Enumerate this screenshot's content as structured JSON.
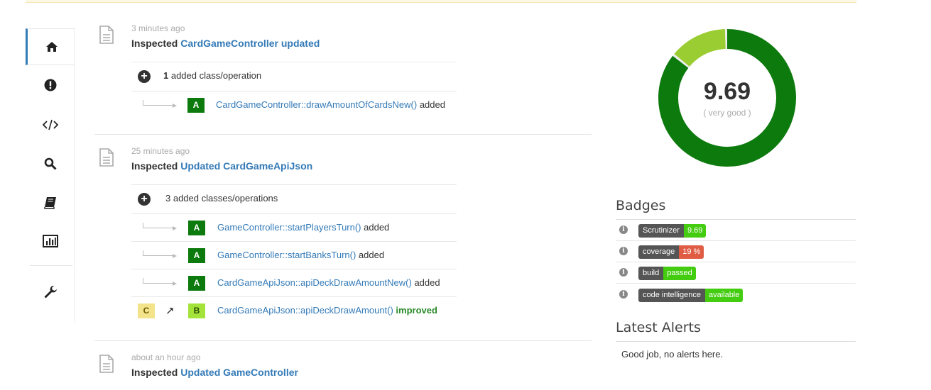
{
  "sidebar": {
    "items": [
      {
        "name": "home-icon",
        "label": "home"
      },
      {
        "name": "alert-icon",
        "label": "issues"
      },
      {
        "name": "code-icon",
        "label": "code"
      },
      {
        "name": "search-icon",
        "label": "search"
      },
      {
        "name": "book-icon",
        "label": "documentation"
      },
      {
        "name": "chart-icon",
        "label": "statistics"
      },
      {
        "name": "wrench-icon",
        "label": "settings"
      }
    ]
  },
  "feed": {
    "entries": [
      {
        "time": "3 minutes ago",
        "prefix": "Inspected ",
        "subject": "CardGameController updated",
        "summary_count": "1",
        "summary_text": " added class/operation",
        "changes": [
          {
            "grade": "A",
            "link": "CardGameController::drawAmountOfCardsNew()",
            "status": " added"
          }
        ]
      },
      {
        "time": "25 minutes ago",
        "prefix": "Inspected ",
        "subject": "Updated CardGameApiJson",
        "summary_count": "3",
        "summary_text": " added classes/operations",
        "changes": [
          {
            "grade": "A",
            "link": "GameController::startPlayersTurn()",
            "status": " added"
          },
          {
            "grade": "A",
            "link": "GameController::startBanksTurn()",
            "status": " added"
          },
          {
            "grade": "A",
            "link": "CardGameApiJson::apiDeckDrawAmountNew()",
            "status": " added"
          },
          {
            "from_grade": "C",
            "grade": "B",
            "link": "CardGameApiJson::apiDeckDrawAmount()",
            "status": " improved"
          }
        ]
      },
      {
        "time": "about an hour ago",
        "prefix": "Inspected ",
        "subject": "Updated GameController"
      }
    ]
  },
  "score": {
    "value": "9.69",
    "label": "( very good )",
    "fraction_good": 0.86,
    "fraction_satisfactory": 0.14,
    "colors": {
      "good": "#0d7a0d",
      "satisfactory": "#9acd32"
    }
  },
  "badges": {
    "heading": "Badges",
    "info_glyph": "i",
    "items": [
      {
        "key": "Scrutinizer",
        "value": "9.69",
        "color": "#4c1"
      },
      {
        "key": "coverage",
        "value": "19 %",
        "color": "#e05d44"
      },
      {
        "key": "build",
        "value": "passed",
        "color": "#4c1"
      },
      {
        "key": "code intelligence",
        "value": "available",
        "color": "#4c1"
      }
    ]
  },
  "alerts": {
    "heading": "Latest Alerts",
    "text": "Good job, no alerts here."
  }
}
